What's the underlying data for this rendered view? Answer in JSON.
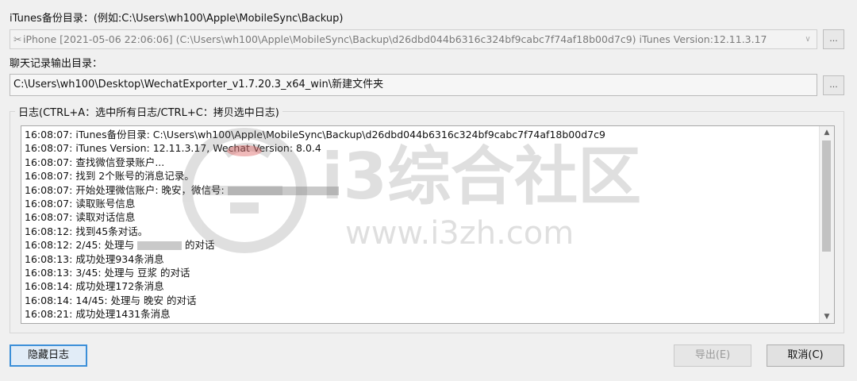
{
  "itunes": {
    "label": "iTunes备份目录：(例如:C:\\Users\\wh100\\Apple\\MobileSync\\Backup)",
    "selected": "iPhone [2021-05-06 22:06:06] (C:\\Users\\wh100\\Apple\\MobileSync\\Backup\\d26dbd044b6316c324bf9cabc7f74af18b00d7c9) iTunes Version:12.11.3.17",
    "browse_label": "..."
  },
  "output": {
    "label": "聊天记录输出目录：",
    "value": "C:\\Users\\wh100\\Desktop\\WechatExporter_v1.7.20.3_x64_win\\新建文件夹",
    "browse_label": "..."
  },
  "log": {
    "title": "日志(CTRL+A：选中所有日志/CTRL+C：拷贝选中日志)",
    "lines": [
      "16:08:07: iTunes备份目录: C:\\Users\\wh100\\Apple\\MobileSync\\Backup\\d26dbd044b6316c324bf9cabc7f74af18b00d7c9",
      "16:08:07: iTunes Version: 12.11.3.17, Wechat Version: 8.0.4",
      "16:08:07: 查找微信登录账户...",
      "16:08:07: 找到 2个账号的消息记录。",
      "16:08:07: 开始处理微信账户: 晚安，微信号: ",
      "16:08:07: 读取账号信息",
      "16:08:07: 读取对话信息",
      "16:08:12: 找到45条对话。",
      "16:08:12: 2/45: 处理与 ",
      "16:08:13: 成功处理934条消息",
      "16:08:13: 3/45: 处理与 豆浆 的对话",
      "16:08:14: 成功处理172条消息",
      "16:08:14: 14/45: 处理与 晚安 的对话",
      "16:08:21: 成功处理1431条消息"
    ],
    "line9_suffix": " 的对话"
  },
  "watermark": {
    "title": "i3综合社区",
    "url": "www.i3zh.com"
  },
  "buttons": {
    "hide_log": "隐藏日志",
    "export": "导出(E)",
    "cancel": "取消(C)"
  }
}
